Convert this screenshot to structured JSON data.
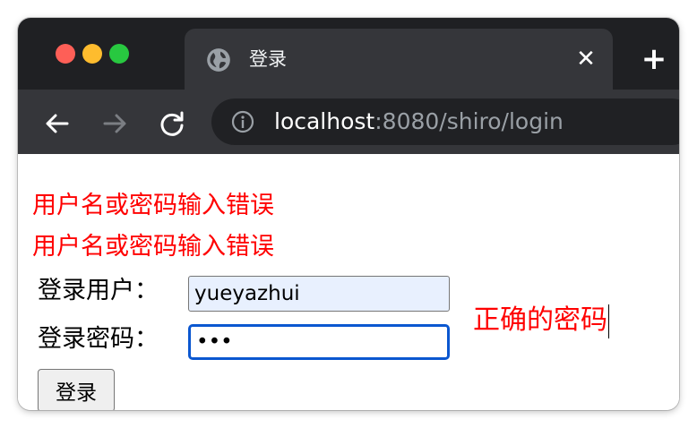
{
  "browser": {
    "tab_title": "登录",
    "tab_close": "✕",
    "new_tab": "+",
    "url_host": "localhost",
    "url_rest": ":8080/shiro/login"
  },
  "page": {
    "errors": [
      "用户名或密码输入错误",
      "用户名或密码输入错误"
    ],
    "username_label": "登录用户：",
    "username_value": "yueyazhui",
    "password_label": "登录密码：",
    "password_value": "123",
    "login_button": "登录"
  },
  "annotation": {
    "text": "正确的密码"
  },
  "colors": {
    "error_text": "#ff0000",
    "focus_border": "#0b57d0",
    "autofill_bg": "#e8f0fe",
    "tabstrip_bg": "#1f2023",
    "toolbar_bg": "#35363a"
  }
}
